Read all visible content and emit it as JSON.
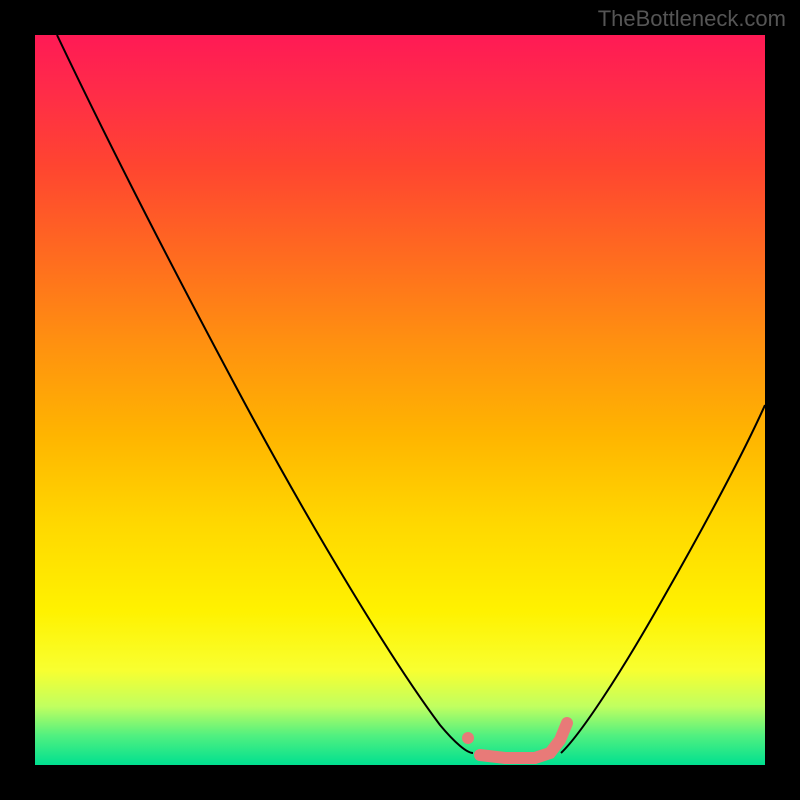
{
  "watermark": "TheBottleneck.com",
  "chart_data": {
    "type": "line",
    "title": "",
    "xlabel": "",
    "ylabel": "",
    "xlim": [
      0,
      100
    ],
    "ylim": [
      0,
      100
    ],
    "series": [
      {
        "name": "left-curve",
        "x": [
          3,
          10,
          20,
          30,
          40,
          50,
          55,
          58,
          60
        ],
        "y": [
          100,
          87,
          69,
          52,
          36,
          19,
          10,
          5,
          2
        ]
      },
      {
        "name": "right-curve",
        "x": [
          72,
          76,
          82,
          88,
          94,
          100
        ],
        "y": [
          2,
          6,
          15,
          27,
          40,
          54
        ]
      },
      {
        "name": "bottom-pink-highlight",
        "x": [
          59,
          61,
          65,
          69,
          72,
          73
        ],
        "y": [
          3,
          1,
          1,
          1,
          2,
          5
        ]
      }
    ],
    "background_gradient": {
      "top": "#ff1a55",
      "mid": "#fff200",
      "bottom": "#00e090"
    }
  }
}
